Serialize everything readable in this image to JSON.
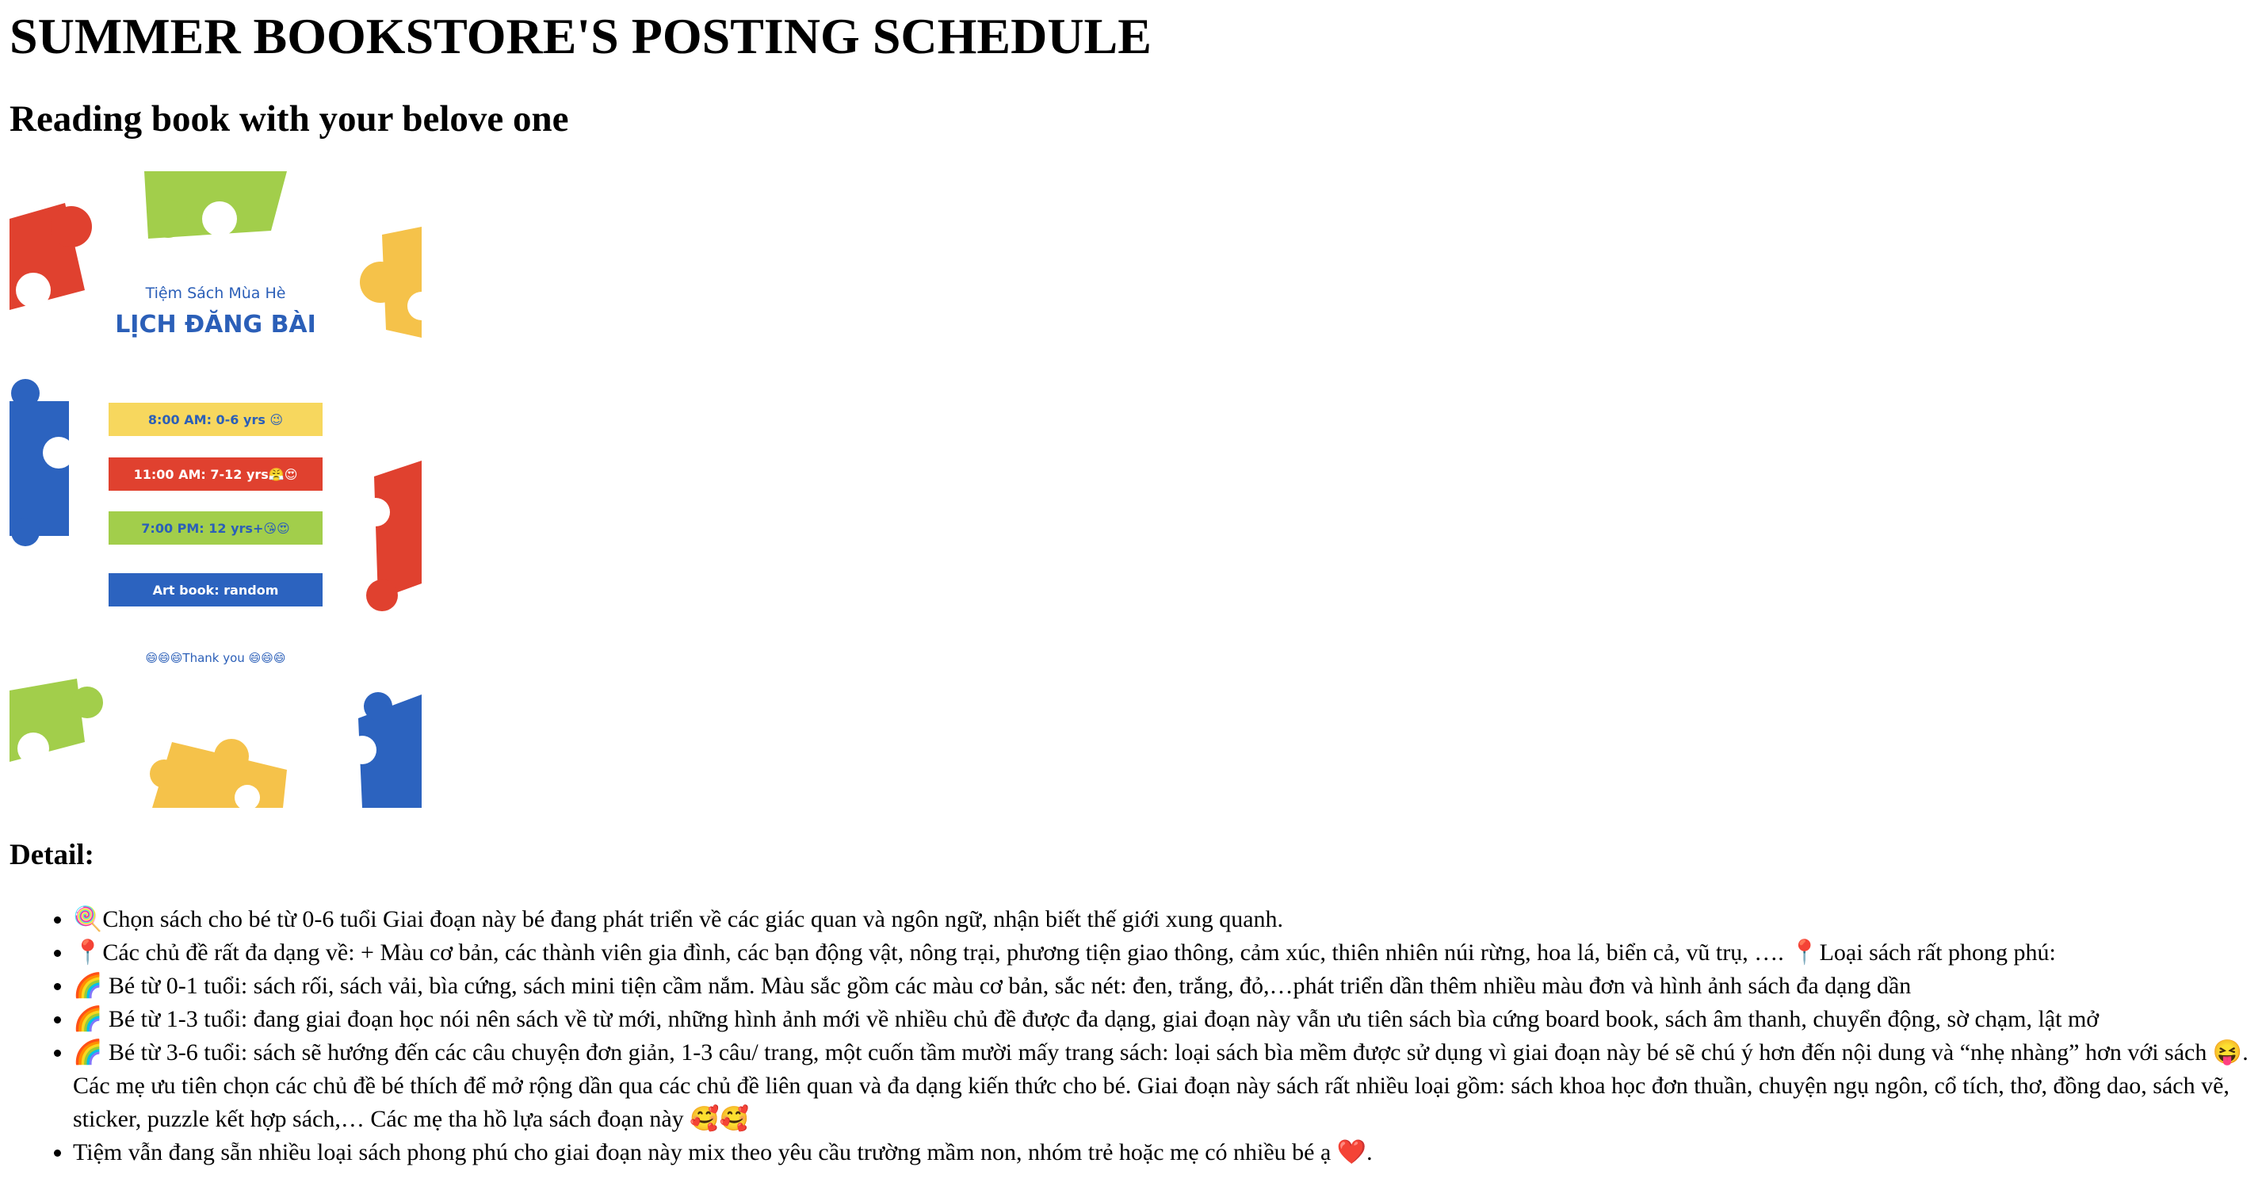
{
  "page": {
    "title": "SUMMER BOOKSTORE'S POSTING SCHEDULE",
    "subtitle": "Reading book with your belove one",
    "detail_heading": "Detail:"
  },
  "poster": {
    "shop_name": "Tiệm Sách Mùa Hè",
    "heading": "LỊCH ĐĂNG BÀI",
    "slots": [
      {
        "label": "8:00 AM: 0-6 yrs 😉",
        "color": "#F7D75E",
        "text_color": "#2B5FB8"
      },
      {
        "label": "11:00 AM: 7-12 yrs😤😍",
        "color": "#E0412F",
        "text_color": "#FFFFFF"
      },
      {
        "label": "7:00 PM: 12 yrs+😘😍",
        "color": "#A2CE4B",
        "text_color": "#2B5FB8"
      },
      {
        "label": "Art book: random",
        "color": "#2C63BF",
        "text_color": "#FFFFFF"
      }
    ],
    "thanks": "😄😄😄Thank you 😄😄😄",
    "colors": {
      "red": "#E0412F",
      "green": "#A2CE4B",
      "yellow": "#F5C24A",
      "blue": "#2C63BF",
      "title_blue": "#2B5FB8"
    }
  },
  "details": [
    "🍭Chọn sách cho bé từ 0-6 tuổi Giai đoạn này bé đang phát triển về các giác quan và ngôn ngữ, nhận biết thế giới xung quanh.",
    "📍Các chủ đề rất đa dạng về: + Màu cơ bản, các thành viên gia đình, các bạn động vật, nông trại, phương tiện giao thông, cảm xúc, thiên nhiên núi rừng, hoa lá, biển cả, vũ trụ, …. 📍Loại sách rất phong phú:",
    "🌈 Bé từ 0-1 tuổi: sách rối, sách vải, bìa cứng, sách mini tiện cầm nắm. Màu sắc gồm các màu cơ bản, sắc nét: đen, trắng, đỏ,…phát triển dần thêm nhiều màu đơn và hình ảnh sách đa dạng dần",
    "🌈 Bé từ 1-3 tuổi: đang giai đoạn học nói nên sách về từ mới, những hình ảnh mới về nhiều chủ đề được đa dạng, giai đoạn này vẫn ưu tiên sách bìa cứng board book, sách âm thanh, chuyển động, sờ chạm, lật mở",
    "🌈 Bé từ 3-6 tuổi: sách sẽ hướng đến các câu chuyện đơn giản, 1-3 câu/ trang, một cuốn tầm mười mấy trang sách: loại sách bìa mềm được sử dụng vì giai đoạn này bé sẽ chú ý hơn đến nội dung và “nhẹ nhàng” hơn với sách 😝. Các mẹ ưu tiên chọn các chủ đề bé thích để mở rộng dần qua các chủ đề liên quan và đa dạng kiến thức cho bé. Giai đoạn này sách rất nhiều loại gồm: sách khoa học đơn thuần, chuyện ngụ ngôn, cổ tích, thơ, đồng dao, sách vẽ, sticker, puzzle kết hợp sách,… Các mẹ tha hồ lựa sách đoạn này 🥰🥰",
    "Tiệm vẫn đang sẵn nhiều loại sách phong phú cho giai đoạn này mix theo yêu cầu trường mầm non, nhóm trẻ hoặc mẹ có nhiều bé ạ ❤️."
  ]
}
